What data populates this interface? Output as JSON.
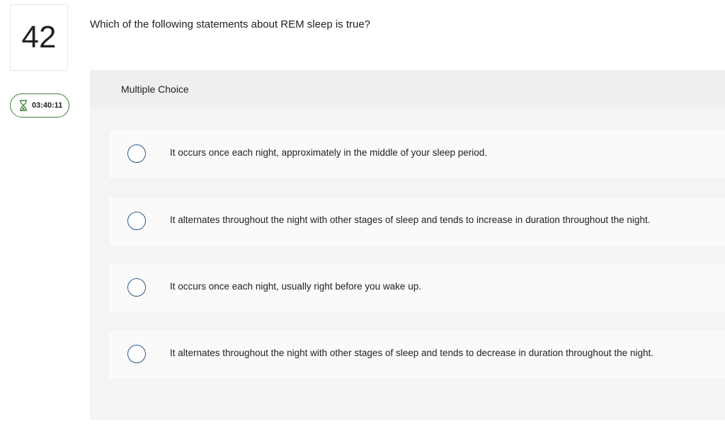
{
  "question_number": "42",
  "timer": {
    "icon": "hourglass-icon",
    "value": "03:40:11",
    "border_color": "#3f7f3a"
  },
  "question": {
    "text": "Which of the following statements about REM sleep is true?"
  },
  "answer_panel": {
    "type_label": "Multiple Choice",
    "options": [
      {
        "label": "It occurs once each night, approximately in the middle of your sleep period.",
        "selected": false
      },
      {
        "label": "It alternates throughout the night with other stages of sleep and tends to increase in duration throughout the night.",
        "selected": false
      },
      {
        "label": "It occurs once each night, usually right before you wake up.",
        "selected": false
      },
      {
        "label": "It alternates throughout the night with other stages of sleep and tends to decrease in duration throughout the night.",
        "selected": false
      }
    ]
  },
  "colors": {
    "radio_border": "#2d5a86",
    "panel_background": "#f4f4f4"
  }
}
